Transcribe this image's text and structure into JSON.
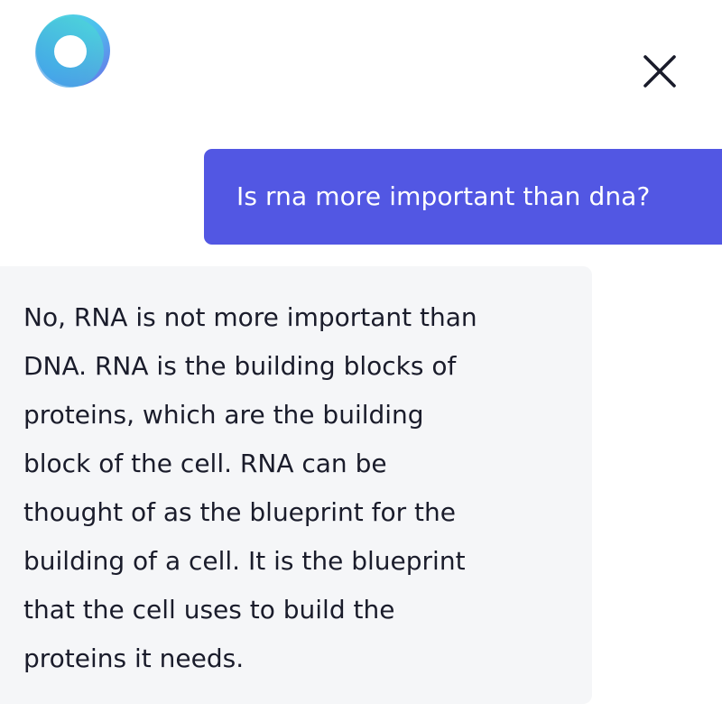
{
  "header": {
    "logo_icon": "ring-logo-icon",
    "close_icon": "close-icon"
  },
  "chat": {
    "user_message": "Is rna more important than dna?",
    "assistant_message_lines": [
      "No, RNA is not more important than",
      "DNA. RNA is the building blocks of",
      "proteins, which are the building",
      "block of the cell. RNA can be",
      "thought of as the blueprint for the",
      "building of a cell. It is the blueprint",
      "that the cell uses to build the",
      "proteins it needs."
    ]
  },
  "colors": {
    "user_bubble": "#5257e3",
    "assistant_bubble": "#f5f6f8",
    "text_dark": "#1a1c2b",
    "close_icon": "#1a1c2b"
  }
}
